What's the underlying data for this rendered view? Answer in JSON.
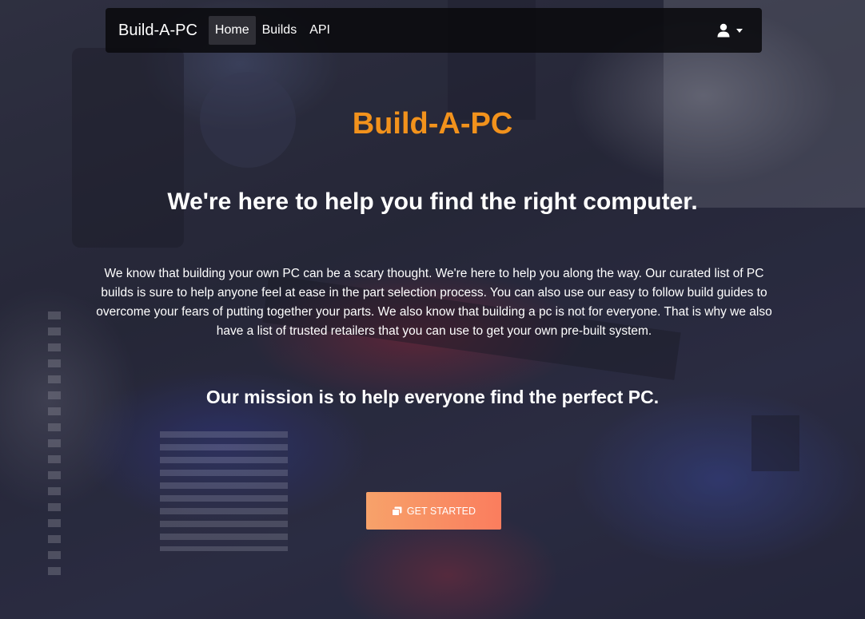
{
  "navbar": {
    "brand": "Build-A-PC",
    "links": [
      {
        "label": "Home",
        "active": true
      },
      {
        "label": "Builds",
        "active": false
      },
      {
        "label": "API",
        "active": false
      }
    ],
    "user_icon": "user-icon"
  },
  "hero": {
    "title": "Build-A-PC",
    "tagline": "We're here to help you find the right computer.",
    "description": "We know that building your own PC can be a scary thought. We're here to help you along the way. Our curated list of PC builds is sure to help anyone feel at ease in the part selection process. You can also use our easy to follow build guides to overcome your fears of putting together your parts. We also know that building a pc is not for everyone. That is why we also have a list of trusted retailers that you can use to get your own pre-built system.",
    "mission": "Our mission is to help everyone find the perfect PC.",
    "cta": {
      "label": "GET STARTED",
      "icon": "clone-icon"
    }
  },
  "colors": {
    "accent_title": "#f2921c",
    "button_gradient_start": "#f7a26a",
    "button_gradient_end": "#fa7d5e",
    "navbar_bg": "#0a0a0e"
  }
}
